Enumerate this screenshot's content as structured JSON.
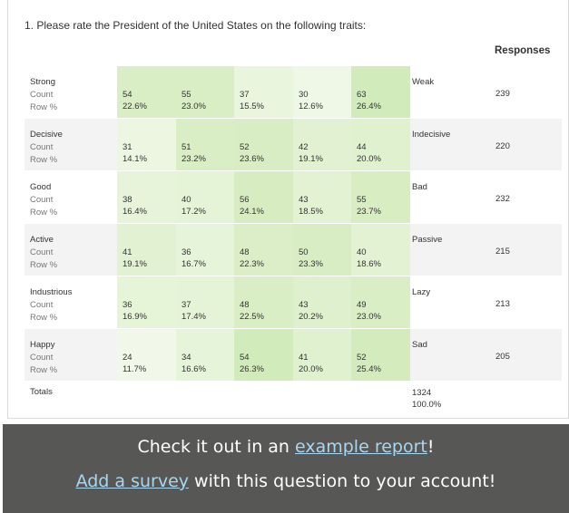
{
  "question": {
    "title": "1. Please rate the President of the United States on the following traits:"
  },
  "table": {
    "responses_header": "Responses",
    "count_label": "Count",
    "rowpct_label": "Row %",
    "rows": [
      {
        "trait": "Strong",
        "opposite": "Weak",
        "responses": "239",
        "cells": [
          {
            "count": "54",
            "pct": "22.6%"
          },
          {
            "count": "55",
            "pct": "23.0%"
          },
          {
            "count": "37",
            "pct": "15.5%"
          },
          {
            "count": "30",
            "pct": "12.6%"
          },
          {
            "count": "63",
            "pct": "26.4%"
          }
        ]
      },
      {
        "trait": "Decisive",
        "opposite": "Indecisive",
        "responses": "220",
        "cells": [
          {
            "count": "31",
            "pct": "14.1%"
          },
          {
            "count": "51",
            "pct": "23.2%"
          },
          {
            "count": "52",
            "pct": "23.6%"
          },
          {
            "count": "42",
            "pct": "19.1%"
          },
          {
            "count": "44",
            "pct": "20.0%"
          }
        ]
      },
      {
        "trait": "Good",
        "opposite": "Bad",
        "responses": "232",
        "cells": [
          {
            "count": "38",
            "pct": "16.4%"
          },
          {
            "count": "40",
            "pct": "17.2%"
          },
          {
            "count": "56",
            "pct": "24.1%"
          },
          {
            "count": "43",
            "pct": "18.5%"
          },
          {
            "count": "55",
            "pct": "23.7%"
          }
        ]
      },
      {
        "trait": "Active",
        "opposite": "Passive",
        "responses": "215",
        "cells": [
          {
            "count": "41",
            "pct": "19.1%"
          },
          {
            "count": "36",
            "pct": "16.7%"
          },
          {
            "count": "48",
            "pct": "22.3%"
          },
          {
            "count": "50",
            "pct": "23.3%"
          },
          {
            "count": "40",
            "pct": "18.6%"
          }
        ]
      },
      {
        "trait": "Industrious",
        "opposite": "Lazy",
        "responses": "213",
        "cells": [
          {
            "count": "36",
            "pct": "16.9%"
          },
          {
            "count": "37",
            "pct": "17.4%"
          },
          {
            "count": "48",
            "pct": "22.5%"
          },
          {
            "count": "43",
            "pct": "20.2%"
          },
          {
            "count": "49",
            "pct": "23.0%"
          }
        ]
      },
      {
        "trait": "Happy",
        "opposite": "Sad",
        "responses": "205",
        "cells": [
          {
            "count": "24",
            "pct": "11.7%"
          },
          {
            "count": "34",
            "pct": "16.6%"
          },
          {
            "count": "54",
            "pct": "26.3%"
          },
          {
            "count": "41",
            "pct": "20.0%"
          },
          {
            "count": "52",
            "pct": "25.4%"
          }
        ]
      }
    ],
    "totals": {
      "label": "Totals",
      "count": "1324",
      "pct": "100.0%"
    }
  },
  "cta": {
    "line1_prefix": "Check it out in an ",
    "line1_link": "example report",
    "line1_suffix": "!",
    "line2_link": "Add a survey",
    "line2_suffix": " with this question to your account!"
  },
  "colors": {
    "cta_background": "#575755",
    "link": "#a9d6f0",
    "row_band": "#f3f3f3"
  }
}
